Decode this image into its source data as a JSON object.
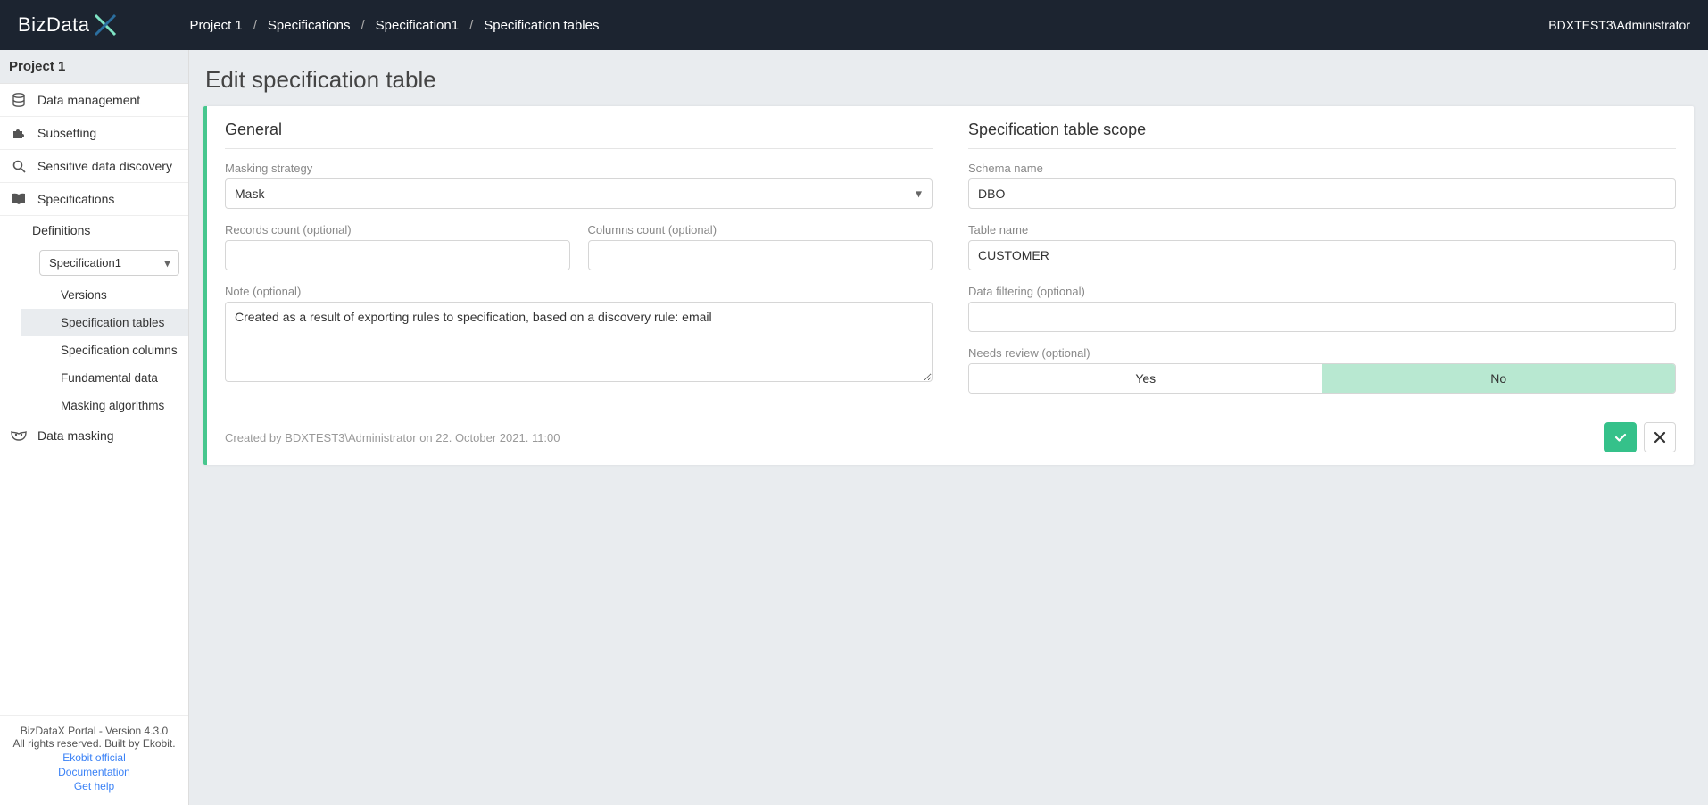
{
  "header": {
    "logo_text": "BizData",
    "user": "BDXTEST3\\Administrator"
  },
  "breadcrumb": {
    "items": [
      "Project 1",
      "Specifications",
      "Specification1",
      "Specification tables"
    ]
  },
  "sidebar": {
    "project": "Project 1",
    "items": {
      "data_management": "Data management",
      "subsetting": "Subsetting",
      "sensitive": "Sensitive data discovery",
      "specifications": "Specifications",
      "data_masking": "Data masking"
    },
    "definitions_label": "Definitions",
    "spec_selected": "Specification1",
    "spec_children": {
      "versions": "Versions",
      "spec_tables": "Specification tables",
      "spec_columns": "Specification columns",
      "fundamental": "Fundamental data",
      "masking_algos": "Masking algorithms"
    },
    "footer": {
      "line1": "BizDataX Portal - Version 4.3.0",
      "line2": "All rights reserved. Built by Ekobit.",
      "link1": "Ekobit official",
      "link2": "Documentation",
      "link3": "Get help"
    }
  },
  "page": {
    "title": "Edit specification table",
    "general": {
      "heading": "General",
      "masking_label": "Masking strategy",
      "masking_value": "Mask",
      "records_label": "Records count (optional)",
      "records_value": "",
      "columns_label": "Columns count (optional)",
      "columns_value": "",
      "note_label": "Note (optional)",
      "note_value": "Created as a result of exporting rules to specification, based on a discovery rule: email"
    },
    "scope": {
      "heading": "Specification table scope",
      "schema_label": "Schema name",
      "schema_value": "DBO",
      "table_label": "Table name",
      "table_value": "CUSTOMER",
      "filter_label": "Data filtering (optional)",
      "filter_value": "",
      "review_label": "Needs review (optional)",
      "review_yes": "Yes",
      "review_no": "No",
      "review_selected": "No"
    },
    "meta": "Created by BDXTEST3\\Administrator on 22. October 2021. 11:00"
  }
}
